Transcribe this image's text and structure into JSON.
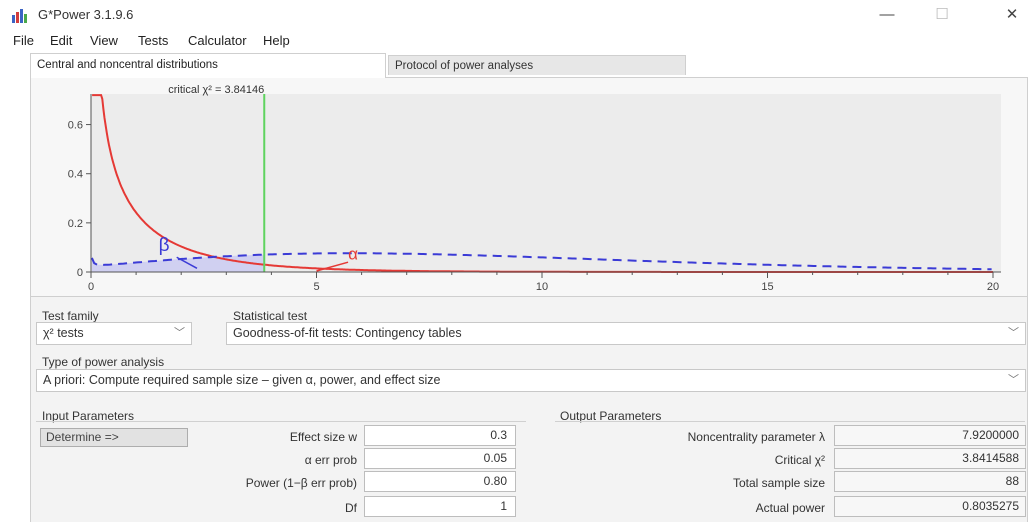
{
  "window": {
    "title": "G*Power 3.1.9.6",
    "minimize": "—",
    "maximize": "☐",
    "close": "✕"
  },
  "menu": [
    "File",
    "Edit",
    "View",
    "Tests",
    "Calculator",
    "Help"
  ],
  "tabs": [
    {
      "label": "Central and noncentral distributions",
      "active": true
    },
    {
      "label": "Protocol of power analyses",
      "active": false
    }
  ],
  "plot": {
    "critical_label": "critical χ² = 3.84146",
    "critical_value": 3.84146,
    "xlim": [
      0,
      20
    ],
    "ylim": [
      0,
      0.7
    ],
    "xticks": [
      "0",
      "5",
      "10",
      "15",
      "20"
    ],
    "yticks": [
      "0",
      "0.2",
      "0.4",
      "0.6"
    ],
    "beta_label": "β",
    "alpha_label": "α",
    "noncentrality": 7.92,
    "df": 1,
    "colors": {
      "central": "#e53935",
      "noncentral": "#3b3bd6",
      "critical": "#5fd35f",
      "beta_fill": "#c9c9f2"
    }
  },
  "test_family": {
    "label": "Test family",
    "value": "χ² tests"
  },
  "statistical_test": {
    "label": "Statistical test",
    "value": "Goodness-of-fit tests: Contingency tables"
  },
  "analysis_type": {
    "label": "Type of power analysis",
    "value": "A priori: Compute required sample size – given α, power, and effect size"
  },
  "input": {
    "header": "Input Parameters",
    "determine_button": "Determine =>",
    "effect_size_label": "Effect size w",
    "effect_size_value": "0.3",
    "alpha_label": "α err prob",
    "alpha_value": "0.05",
    "power_label": "Power (1−β err prob)",
    "power_value": "0.80",
    "df_label": "Df",
    "df_value": "1"
  },
  "output": {
    "header": "Output Parameters",
    "lambda_label": "Noncentrality parameter λ",
    "lambda_value": "7.9200000",
    "critical_label": "Critical χ²",
    "critical_value": "3.8414588",
    "sample_label": "Total sample size",
    "sample_value": "88",
    "power_label": "Actual power",
    "power_value": "0.8035275"
  }
}
